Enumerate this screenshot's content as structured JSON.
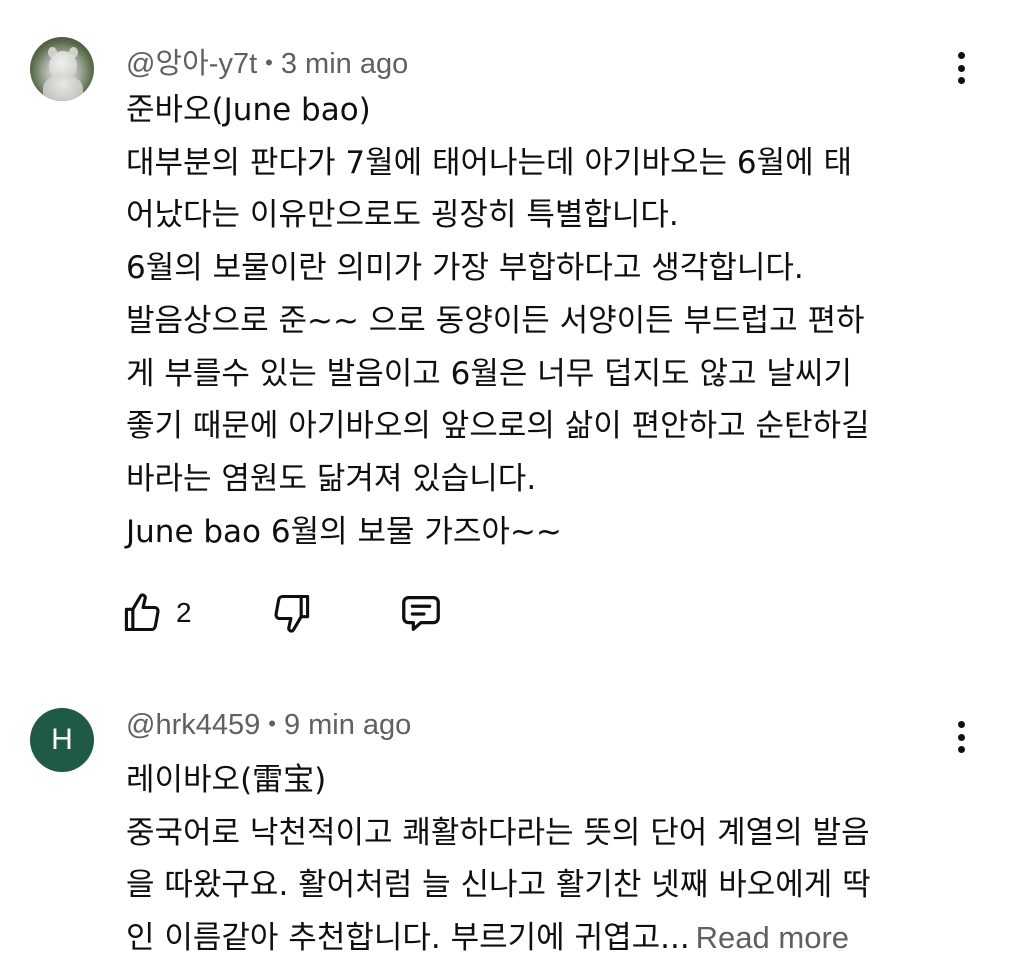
{
  "comments": [
    {
      "author": "@앙아-y7t",
      "separator": "•",
      "time": "3 min ago",
      "avatar": {
        "type": "photo",
        "icon": "panda-statue-avatar"
      },
      "lines": [
        "준바오(June bao)",
        "대부분의 판다가 7월에 태어나는데 아기바오는 6월에 태",
        "어났다는 이유만으로도 굉장히 특별합니다.",
        "6월의 보물이란 의미가 가장 부합하다고 생각합니다.",
        "발음상으로 준~~ 으로 동양이든 서양이든 부드럽고 편하",
        "게 부를수 있는 발음이고 6월은 너무 덥지도 않고 날씨기",
        "좋기 때문에 아기바오의 앞으로의 삶이 편안하고 순탄하길",
        "바라는 염원도 닮겨져 있습니다.",
        "June bao  6월의 보물 가즈아~~"
      ],
      "likes": "2"
    },
    {
      "author": "@hrk4459",
      "separator": "•",
      "time": "9 min ago",
      "avatar": {
        "type": "letter",
        "letter": "H",
        "color": "#1f5a45"
      },
      "lines": [
        "레이바오(雷宝)",
        "중국어로 낙천적이고 쾌활하다라는 뜻의 단어 계열의 발음",
        "을 따왔구요. 활어처럼 늘 신나고 활기찬 넷째 바오에게 딱",
        "인 이름같아 추천합니다. 부르기에 귀엽고..."
      ],
      "read_more": "Read more"
    }
  ],
  "icons": {
    "like": "thumbs-up-icon",
    "dislike": "thumbs-down-icon",
    "reply": "reply-icon",
    "menu": "more-vertical-icon"
  },
  "colors": {
    "text": "#0f0f0f",
    "secondary": "#606060",
    "avatar_h": "#1f5a45",
    "background": "#ffffff"
  }
}
